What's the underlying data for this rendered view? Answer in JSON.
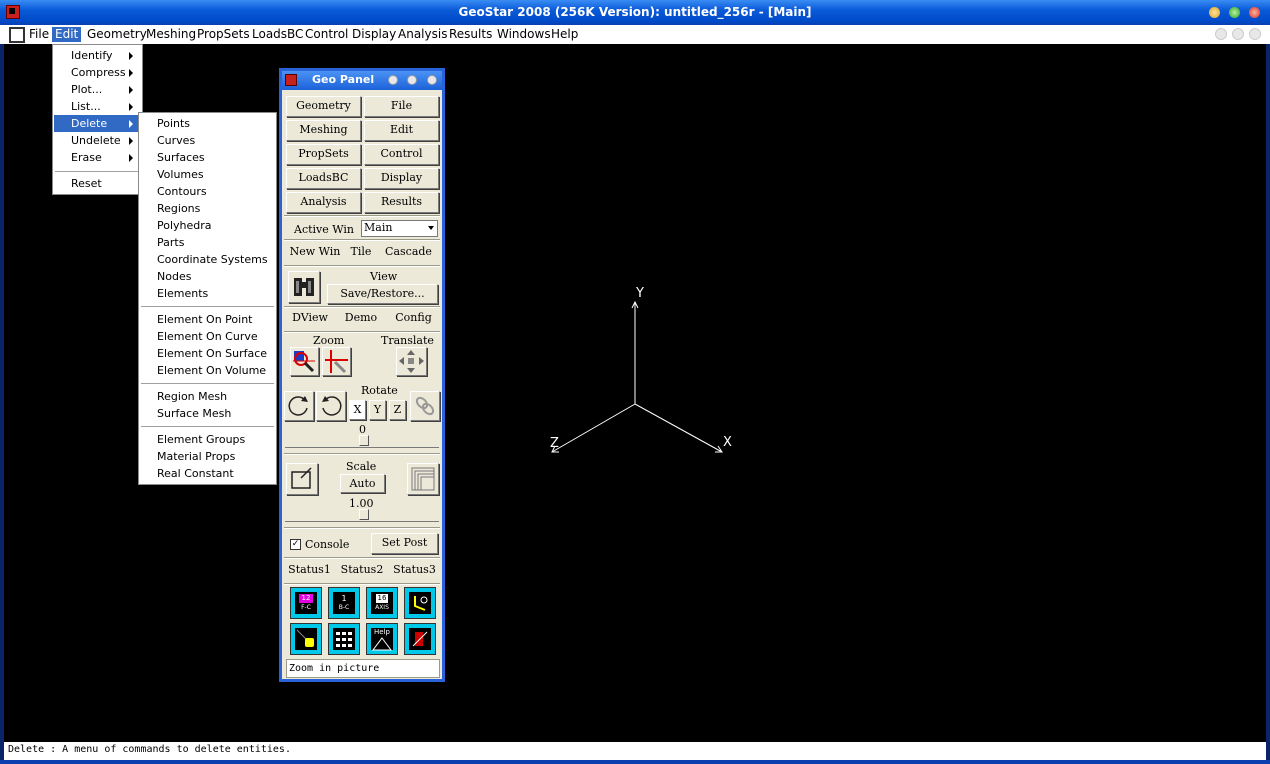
{
  "window": {
    "title": "GeoStar 2008 (256K Version): untitled_256r - [Main]"
  },
  "menubar": {
    "items": [
      "File",
      "Edit",
      "Geometry",
      "Meshing",
      "PropSets",
      "LoadsBC",
      "Control",
      "Display",
      "Analysis",
      "Results",
      "Windows",
      "Help"
    ]
  },
  "edit_menu": {
    "items": [
      "Identify",
      "Compress",
      "Plot...",
      "List...",
      "Delete",
      "Undelete",
      "Erase",
      "Reset"
    ]
  },
  "delete_submenu": {
    "group1": [
      "Points",
      "Curves",
      "Surfaces",
      "Volumes",
      "Contours",
      "Regions",
      "Polyhedra",
      "Parts",
      "Coordinate Systems",
      "Nodes",
      "Elements"
    ],
    "group2": [
      "Element On Point",
      "Element On Curve",
      "Element On Surface",
      "Element On Volume"
    ],
    "group3": [
      "Region Mesh",
      "Surface Mesh"
    ],
    "group4": [
      "Element Groups",
      "Material Props",
      "Real Constant"
    ]
  },
  "geo_panel": {
    "title": "Geo Panel",
    "buttons": [
      "Geometry",
      "File",
      "Meshing",
      "Edit",
      "PropSets",
      "Control",
      "LoadsBC",
      "Display",
      "Analysis",
      "Results"
    ],
    "active_win_label": "Active Win",
    "active_win_value": "Main",
    "win_buttons": [
      "New Win",
      "Tile",
      "Cascade"
    ],
    "view_label": "View",
    "save_restore": "Save/Restore...",
    "view_buttons": [
      "DView",
      "Demo",
      "Config"
    ],
    "zoom_label": "Zoom",
    "translate_label": "Translate",
    "rotate_label": "Rotate",
    "axis_x": "X",
    "axis_y": "Y",
    "axis_z": "Z",
    "rotate_value": "0",
    "scale_label": "Scale",
    "scale_auto": "Auto",
    "scale_value": "1.00",
    "console_label": "Console",
    "console_checked": true,
    "set_post": "Set Post",
    "status_buttons": [
      "Status1",
      "Status2",
      "Status3"
    ],
    "tool_labels": {
      "t1": "12",
      "t1b": "F-C",
      "t2": "1",
      "t2b": "B-C",
      "t3": "16",
      "t3b": "AXIS",
      "t7": "Help"
    },
    "hint": "Zoom in picture"
  },
  "viewport": {
    "axis_labels": {
      "x": "X",
      "y": "Y",
      "z": "Z"
    }
  },
  "status": {
    "text": "Delete : A menu of commands to delete entities."
  },
  "colors": {
    "accent": "#316ac5",
    "canvas": "#000000",
    "title": "#0a5bd8"
  }
}
